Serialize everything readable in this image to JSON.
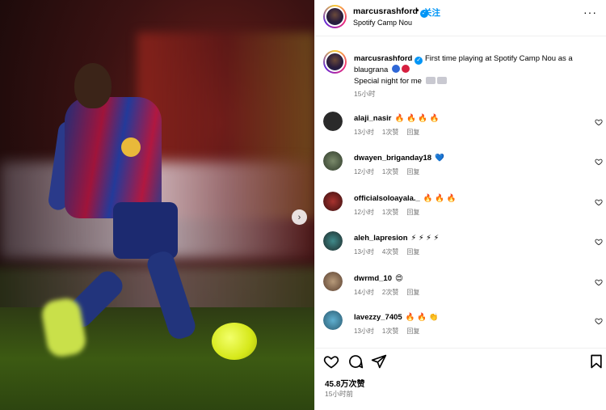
{
  "post": {
    "username": "marcusrashford",
    "follow_label": "关注",
    "dot": "•",
    "location": "Spotify Camp Nou",
    "caption_line1": "First time playing at Spotify Camp Nou as a blaugrana",
    "caption_line2": "Special night for me",
    "caption_time": "15小时",
    "likes": "45.8万次赞",
    "posted_time": "15小时前"
  },
  "comments": [
    {
      "username": "alaji_nasir",
      "emoji": "🔥 🔥 🔥 🔥",
      "time": "13小时",
      "likes": "1次赞",
      "reply": "回复"
    },
    {
      "username": "dwayen_briganday18",
      "emoji": "💙",
      "time": "12小时",
      "likes": "1次赞",
      "reply": "回复"
    },
    {
      "username": "officialsoloayala._",
      "emoji": "🔥 🔥 🔥",
      "time": "12小时",
      "likes": "1次赞",
      "reply": "回复"
    },
    {
      "username": "aleh_lapresion",
      "emoji": "⚡ ⚡ ⚡ ⚡",
      "time": "13小时",
      "likes": "4次赞",
      "reply": "回复"
    },
    {
      "username": "dwrmd_10",
      "emoji": "😍",
      "time": "14小时",
      "likes": "2次赞",
      "reply": "回复"
    },
    {
      "username": "lavezzy_7405",
      "emoji": "🔥 🔥 👏",
      "time": "13小时",
      "likes": "1次赞",
      "reply": "回复"
    }
  ],
  "icons": {
    "more": "more-options-icon",
    "next": "chevron-right-icon",
    "like": "heart-icon",
    "comment": "comment-icon",
    "share": "send-icon",
    "save": "bookmark-icon"
  },
  "colors": {
    "link_blue": "#0095f6",
    "muted": "#737373",
    "divider": "#efefef"
  }
}
